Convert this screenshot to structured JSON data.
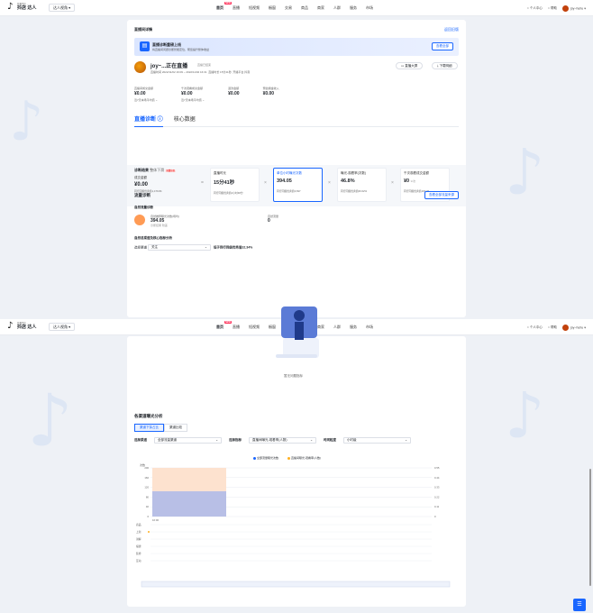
{
  "nav": {
    "logo_small": "巨量百应",
    "logo_big": "抖店 达人",
    "role_select": "达人视角",
    "items": [
      {
        "label": "首页",
        "hot": "NEW"
      },
      {
        "label": "直播"
      },
      {
        "label": "短视频"
      },
      {
        "label": "橱窗"
      },
      {
        "label": "交易"
      },
      {
        "label": "商品"
      },
      {
        "label": "商家"
      },
      {
        "label": "人群"
      },
      {
        "label": "服务"
      },
      {
        "label": "市场"
      }
    ],
    "tools": [
      "个人中心",
      "帮助"
    ],
    "user": "joy~huhu"
  },
  "page": {
    "title": "直播间详情",
    "back_link": "返回旧版"
  },
  "banner": {
    "title": "直播诊断重磅上线",
    "subtitle": "将直播间问题诊断智能定位，帮您提升整体收益",
    "button": "查看全部"
  },
  "room": {
    "name": "joy~...正在直播",
    "tag": "直播已结束",
    "time": "直播时间 2022/11/02 16:09 ~ 2022/11/02 16:31",
    "duration": "直播时长 15分41秒",
    "device": "开播平台 抖音",
    "btn_screen": "直播大屏",
    "btn_download": "下载明细"
  },
  "stats": [
    {
      "label": "直播间成交金额",
      "value": "¥0.00",
      "cmp": "近7天本场平均值"
    },
    {
      "label": "千次观看成交金额",
      "value": "¥0.00",
      "cmp": "近7天本场平均值"
    },
    {
      "label": "退款金额",
      "value": "¥0.00",
      "cmp": ""
    },
    {
      "label": "预估佣金收入",
      "value": "¥0.00",
      "cmp": ""
    }
  ],
  "tabs": [
    "直播诊断",
    "核心数据"
  ],
  "diagnosis": {
    "title": "诊断结果",
    "result": "整体下滑",
    "badge": "流量较低",
    "metric": "成交金额",
    "value": "¥0.00",
    "cmp": "同行同级优秀值1,479.84"
  },
  "metric_cards": [
    {
      "title": "直播时长",
      "value": "15分41秒",
      "cmp": "同行同级优秀值2小时48分"
    },
    {
      "title": "单位小时曝光次数",
      "value": "394.05",
      "cmp": "同行同级优秀值3,697"
    },
    {
      "title": "曝光-观看率(次数)",
      "value": "46.8%",
      "cmp": "同行同级优秀值60.62%"
    },
    {
      "title": "千次观看成交金额",
      "value": "¥0",
      "unit": "¥/次",
      "cmp": "同行同级优秀值190.39"
    }
  ],
  "flow": {
    "title": "流量诊断",
    "button": "查看全部流量来源",
    "natural_title": "自然流量诊断",
    "item_label": "自然推荐曝光次数(场均)",
    "item_value": "394.05",
    "item_sub": "诊断结果 较差",
    "right_label": "自然流量",
    "right_value": "0",
    "analysis_title": "自然总渠道及核心指标分析",
    "select_label": "选择渠道",
    "select_value": "关注",
    "analysis_note": "低于同行同级优秀值32.34%",
    "empty": "暂无问题指标"
  },
  "channel": {
    "title": "各渠道曝光分析",
    "tabs": [
      "渠道下探占比",
      "渠道比较"
    ],
    "filter1_label": "选择渠道",
    "filter1_value": "全部流量渠道",
    "filter2_label": "选择指标",
    "filter2_value": "直播间曝光-观看率(人数)",
    "filter3_label": "时间粒度",
    "filter3_value": "小时级",
    "legend": [
      {
        "name": "全部流量曝光次数",
        "color": "#1966ff"
      },
      {
        "name": "直播间曝光-观看率(人数)",
        "color": "#ffb020"
      }
    ],
    "y_label": "次数",
    "y_ticks_left": [
      "200",
      "160",
      "120",
      "80",
      "40",
      "0"
    ],
    "y_ticks_right": [
      "0.55",
      "0.44",
      "0.33",
      "0.22",
      "0.11",
      "0"
    ],
    "x_tick": "16:00",
    "row_labels": [
      "商品",
      "上新",
      "讲解",
      "福袋",
      "装修",
      "互动"
    ]
  },
  "chart_data": {
    "type": "area",
    "title": "",
    "x": [
      "16:00"
    ],
    "series": [
      {
        "name": "全部流量曝光次数",
        "values": [
          200
        ]
      },
      {
        "name": "直播间曝光-观看率(人数)",
        "values": [
          0.44
        ]
      }
    ],
    "ylim": [
      0,
      200
    ],
    "y2lim": [
      0,
      0.55
    ],
    "ylabel": "次数"
  },
  "fab": "客服"
}
